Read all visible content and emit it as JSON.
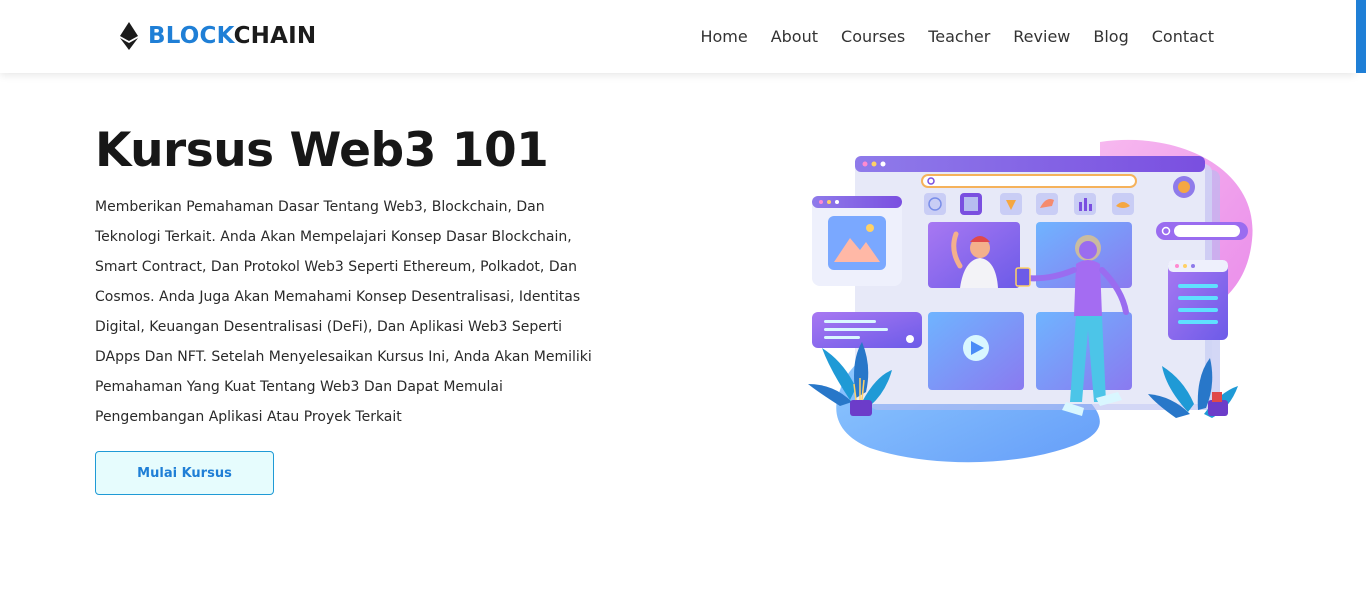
{
  "brand": {
    "part1": "BLOCK",
    "part2": "CHAIN",
    "icon": "ethereum-icon"
  },
  "nav": {
    "items": [
      {
        "label": "Home"
      },
      {
        "label": "About"
      },
      {
        "label": "Courses"
      },
      {
        "label": "Teacher"
      },
      {
        "label": "Review"
      },
      {
        "label": "Blog"
      },
      {
        "label": "Contact"
      }
    ]
  },
  "hero": {
    "title": "Kursus Web3 101",
    "description": "Memberikan Pemahaman Dasar Tentang Web3, Blockchain, Dan Teknologi Terkait. Anda Akan Mempelajari Konsep Dasar Blockchain, Smart Contract, Dan Protokol Web3 Seperti Ethereum, Polkadot, Dan Cosmos. Anda Juga Akan Memahami Konsep Desentralisasi, Identitas Digital, Keuangan Desentralisasi (DeFi), Dan Aplikasi Web3 Seperti DApps Dan NFT. Setelah Menyelesaikan Kursus Ini, Anda Akan Memiliki Pemahaman Yang Kuat Tentang Web3 Dan Dapat Memulai Pengembangan Aplikasi Atau Proyek Terkait",
    "cta_label": "Mulai Kursus"
  },
  "colors": {
    "accent": "#1f7fd6",
    "cta_bg": "#e6fcfd",
    "cta_border": "#1f9ad6"
  }
}
